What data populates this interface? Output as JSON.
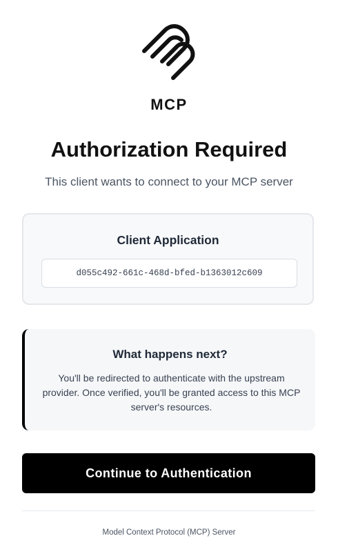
{
  "brand": {
    "name": "MCP",
    "logo_icon": "mcp-logo-icon"
  },
  "header": {
    "title": "Authorization Required",
    "subtitle": "This client wants to connect to your MCP server"
  },
  "client": {
    "label": "Client Application",
    "id": "d055c492-661c-468d-bfed-b1363012c609"
  },
  "info": {
    "title": "What happens next?",
    "body": "You'll be redirected to authenticate with the upstream provider. Once verified, you'll be granted access to this MCP server's resources."
  },
  "actions": {
    "continue_label": "Continue to Authentication"
  },
  "footer": {
    "text": "Model Context Protocol (MCP) Server"
  },
  "colors": {
    "primary": "#000000",
    "card_background": "#f8f9fb",
    "border": "#e5e7eb",
    "muted_text": "#4b5563"
  }
}
